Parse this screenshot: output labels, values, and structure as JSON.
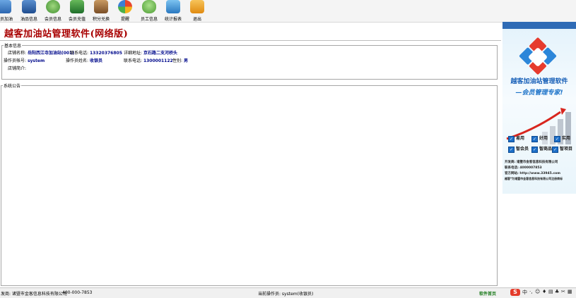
{
  "toolbar": {
    "items": [
      {
        "label": "会员加油",
        "icon": "fuel-icon",
        "color": "#3d7ec9"
      },
      {
        "label": "油品信息",
        "icon": "oil-info-icon",
        "color": "#2c5aa0"
      },
      {
        "label": "会员信息",
        "icon": "member-icon",
        "color": "#5aa34a"
      },
      {
        "label": "会员充值",
        "icon": "recharge-icon",
        "color": "#2f8a3a"
      },
      {
        "label": "积分兑换",
        "icon": "points-icon",
        "color": "#9b6a3c"
      },
      {
        "label": "提醒",
        "icon": "reminder-icon",
        "color": "#e2522f"
      },
      {
        "label": "员工信息",
        "icon": "staff-icon",
        "color": "#6fbf4a"
      },
      {
        "label": "统计报表",
        "icon": "report-icon",
        "color": "#4a9ad8"
      },
      {
        "label": "退出",
        "icon": "exit-icon",
        "color": "#f0a028"
      }
    ]
  },
  "app_title": "越客加油站管理软件(网络版)",
  "basic_info": {
    "legend": "基本信息",
    "store_name_label": "店铺名称:",
    "store_name": "岳阳西江寺加油站(001)",
    "phone_label": "联系电话:",
    "phone": "13320376805",
    "address_label": "详细地址:",
    "address": "京石路二支河桥头",
    "operator_id_label": "操作员帐号:",
    "operator_id": "system",
    "operator_name_label": "操作员姓名:",
    "operator_name": "收银员",
    "op_phone_label": "联系电话:",
    "op_phone": "1300001122",
    "gender_label": "性别:",
    "gender": "男",
    "intro_label": "店铺简介:"
  },
  "notice": {
    "legend": "系统公告"
  },
  "ad": {
    "title": "越客加油站管理软件",
    "slogan": "—会员管理专家!",
    "checks": [
      "易用",
      "好用",
      "实用",
      "智会员",
      "智商品",
      "智项目"
    ],
    "info": [
      "开发商: 诸暨市金客信息科技有限公司",
      "联系电话: 4000007853",
      "官方网站: http://www.33945.com",
      "越客*为诸暨市金客信息科技有限公司注册商标"
    ]
  },
  "status_bar": {
    "developer": "发商: 诸暨市金客信息科技有限公司",
    "phone": "400-000-7853",
    "current_operator": "当前操作员: system(收银员)",
    "link": "软件首页"
  },
  "tray_icons": [
    "input-s-icon",
    "chinese-icon",
    "punctuation-icon",
    "emoji-icon",
    "mic-icon",
    "keyboard-icon",
    "skin-icon",
    "tools-icon",
    "user-icon",
    "grid-icon"
  ]
}
